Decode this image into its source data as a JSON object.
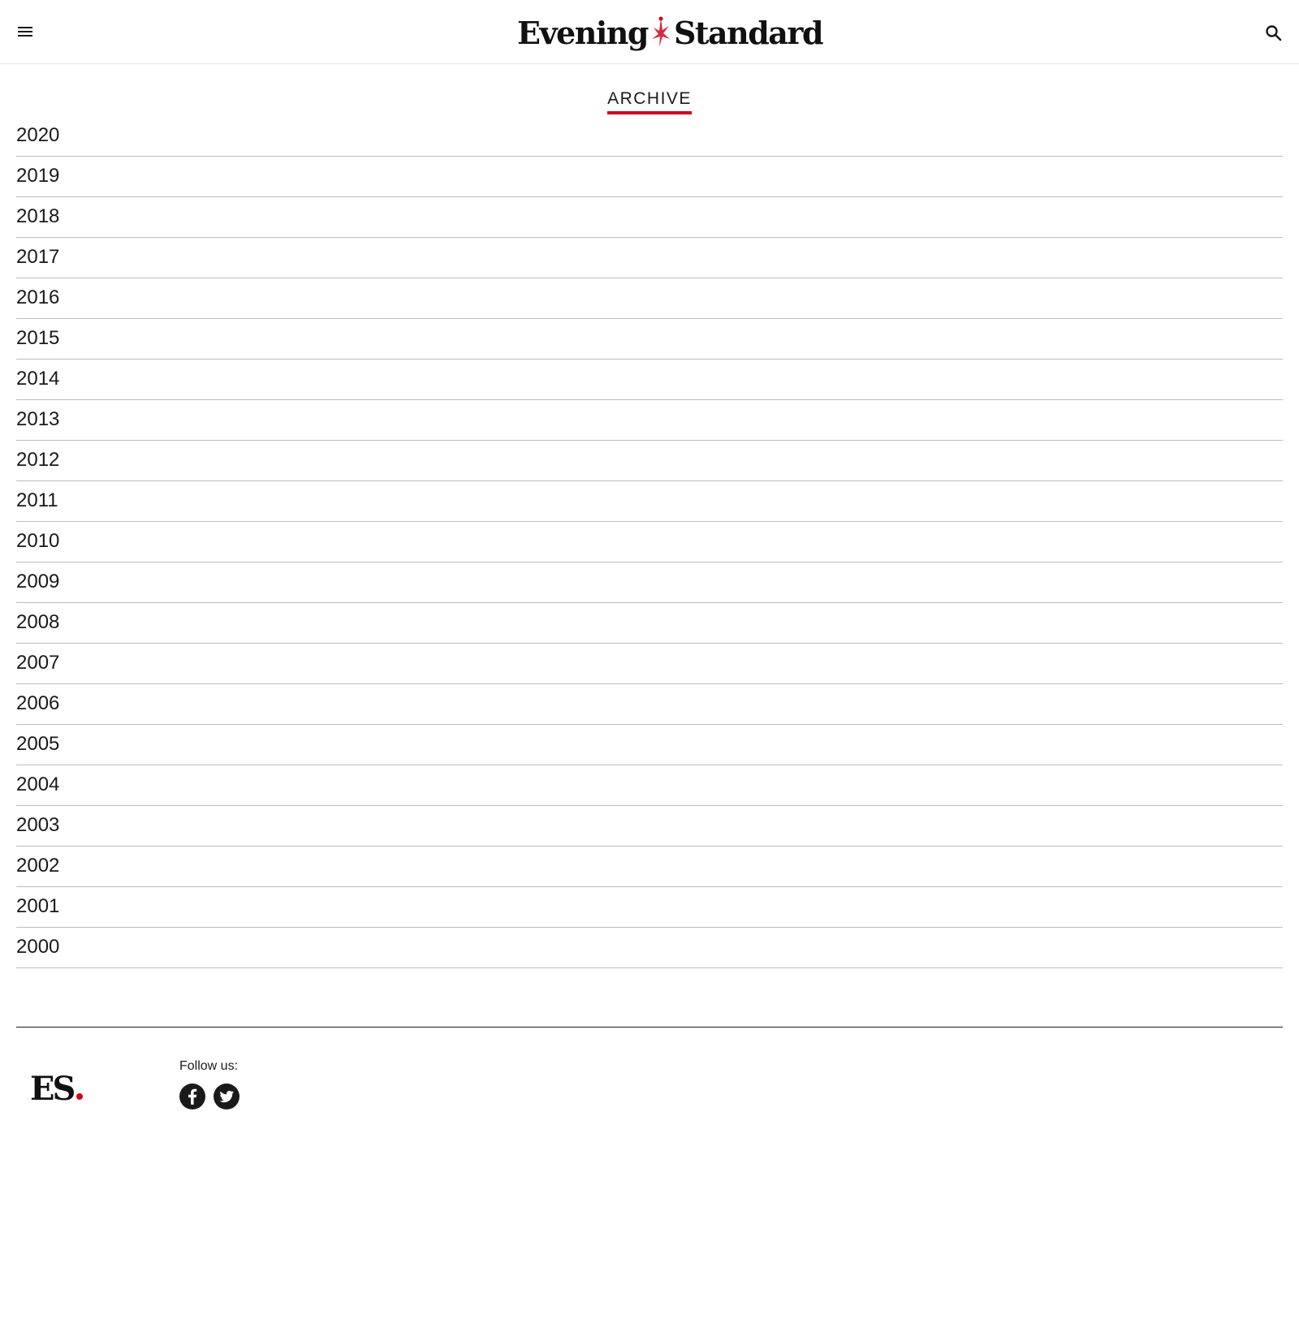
{
  "header": {
    "logo_word_1": "Evening",
    "logo_word_2": "Standard",
    "menu_icon": "hamburger-menu-icon",
    "search_icon": "search-icon"
  },
  "archive": {
    "title": "ARCHIVE",
    "years": [
      "2020",
      "2019",
      "2018",
      "2017",
      "2016",
      "2015",
      "2014",
      "2013",
      "2012",
      "2011",
      "2010",
      "2009",
      "2008",
      "2007",
      "2006",
      "2005",
      "2004",
      "2003",
      "2002",
      "2001",
      "2000"
    ]
  },
  "footer": {
    "logo_text": "ES",
    "follow_label": "Follow us:",
    "social_icons": [
      "facebook-icon",
      "twitter-icon"
    ]
  },
  "colors": {
    "accent": "#d0021b",
    "text": "#1a1a1a",
    "divider": "#bdbdbd"
  }
}
